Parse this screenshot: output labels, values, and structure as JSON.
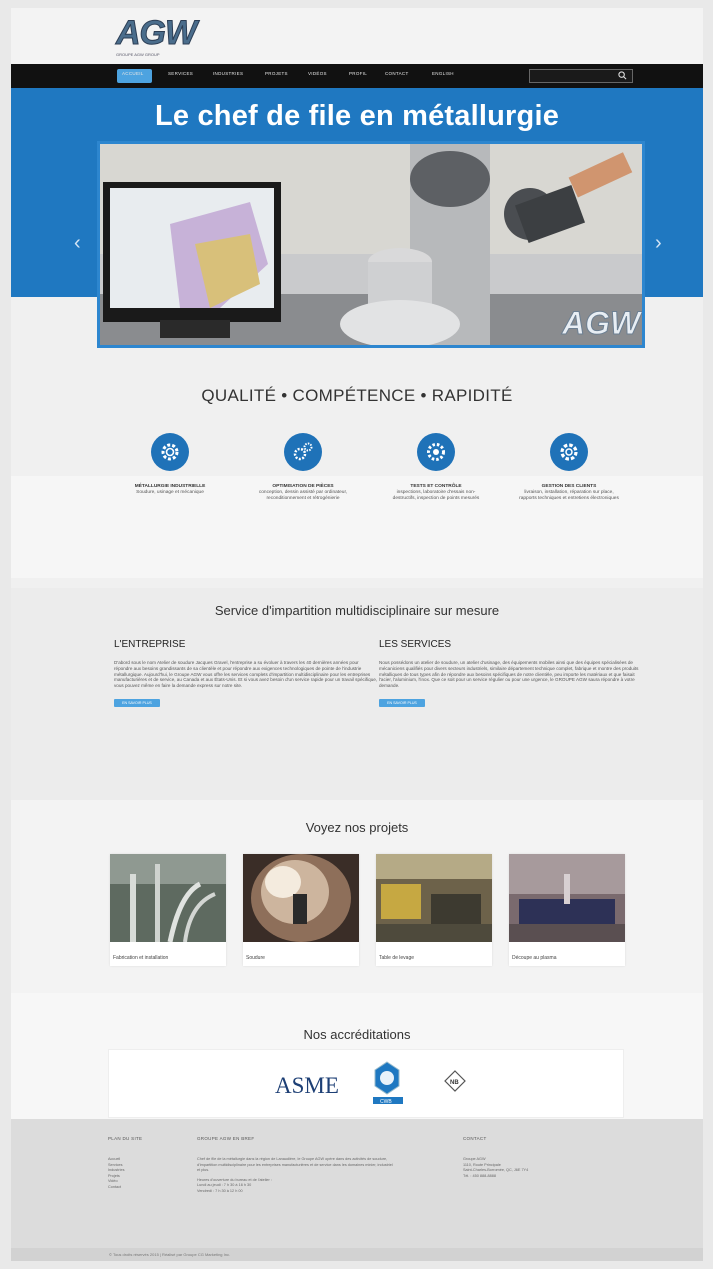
{
  "brand": {
    "logo": "AGW",
    "tagline": "GROUPE AGW GROUP"
  },
  "nav": {
    "items": [
      "ACCUEIL",
      "SERVICES",
      "INDUSTRIES",
      "PROJETS",
      "VIDÉOS",
      "PROFIL",
      "CONTACT",
      "ENGLISH"
    ],
    "search_placeholder": ""
  },
  "hero": {
    "title": "Le chef de file en métallurgie",
    "watermark": "AGW"
  },
  "tagline": "QUALITÉ • COMPÉTENCE • RAPIDITÉ",
  "features": [
    {
      "title": "MÉTALLURGIE INDUSTRIELLE",
      "desc": "Soudure, usinage et mécanique",
      "icon": "gear-icon"
    },
    {
      "title": "OPTIMISATION DE PIÈCES",
      "desc": "conception, dessin assisté par ordinateur, reconditionnement et rétrogénierie",
      "icon": "gears-icon"
    },
    {
      "title": "TESTS ET CONTRÔLE",
      "desc": "inspections, laboratoire d'essais non-destructifs, inspection de points mesurés",
      "icon": "cog-icon"
    },
    {
      "title": "GESTION DES CLIENTS",
      "desc": "livraison, installation, réparation sur place, rapports techniques et entretiens électroniques",
      "icon": "settings-icon"
    }
  ],
  "service": {
    "heading": "Service d'impartition multidisciplinaire sur mesure",
    "left": {
      "title": "L'ENTREPRISE",
      "text": "D'abord sous le nom Atelier de soudure Jacques Gravel, l'entreprise a su évoluer à travers les 40 dernières années pour répondre aux besoins grandissants de sa clientèle et pour répondre aux exigences technologiques de pointe de l'industrie métallurgique. Aujourd'hui, le Groupe AGW vous offre les services complets d'impartition multidisciplinaire pour les entreprises manufacturières et de service, au Canada et aux États-Unis. Et si vous avez besoin d'un service rapide pour un travail spécifique, vous pouvez même en faire la demande express sur notre site.",
      "button": "EN SAVOIR PLUS"
    },
    "right": {
      "title": "LES SERVICES",
      "text": "Nous possédons un atelier de soudure, un atelier d'usinage, des équipements mobiles ainsi que des équipes spécialisées de mécaniciens qualifiés pour divers secteurs industriels, similaire département technique complet, fabrique et montre des produits métalliques de tous types afin de répondre aux besoins spécifiques de notre clientèle, peu importe les matériaux et que faisait l'acier, l'aluminium, l'inox. Que ce soit pour un service régulier ou pour une urgence, le GROUPE AGW saura répondre à votre demande.",
      "button": "EN SAVOIR PLUS"
    }
  },
  "projects": {
    "heading": "Voyez nos projets",
    "items": [
      {
        "label": "Fabrication et installation"
      },
      {
        "label": "Soudure"
      },
      {
        "label": "Table de levage"
      },
      {
        "label": "Découpe au plasma"
      }
    ]
  },
  "accreditations": {
    "heading": "Nos accréditations",
    "logos": [
      "ASME",
      "CWB",
      "NB"
    ]
  },
  "footer": {
    "col1": {
      "title": "PLAN DU SITE",
      "links": [
        "Accueil",
        "Services",
        "Industries",
        "Projets",
        "Vidéo",
        "Contact"
      ]
    },
    "col2": {
      "title": "GROUPE AGW EN BREF",
      "lines": [
        "Chef de file de la métallurgie dans la région de Lanaudière, le Groupe AGW opère dans des activités de soudure,",
        "d'impartition multidisciplinaire pour les entreprises manufacturières et de service dans les domaines minier, industriel",
        "et plus.",
        "Heures d'ouverture du bureau et de l'atelier :",
        "Lundi au jeudi : 7 h 30 à 16 h 30",
        "Vendredi : 7 h 30 à 12 h 00"
      ]
    },
    "col3": {
      "title": "CONTACT",
      "lines": [
        "Groupe AGW",
        "1110, Route Principale",
        "Saint-Charles-Borromée, QC, J6E 7Y4",
        "Tél. : 450 888-8888"
      ]
    },
    "copyright": "© Tous droits réservés 2015 | Réalisé par Groupe CG Marketing Inc."
  },
  "colors": {
    "primary": "#1f78c1",
    "accent": "#4da3e0",
    "nav": "#111111"
  }
}
